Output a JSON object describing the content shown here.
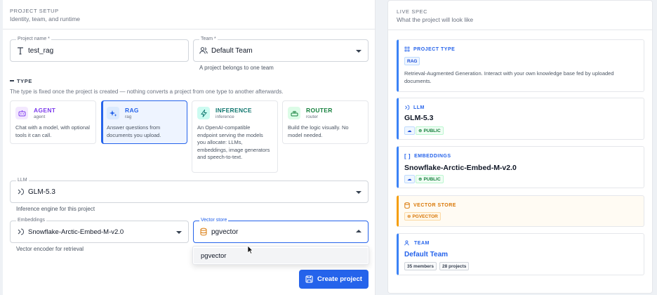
{
  "project_setup": {
    "title": "PROJECT SETUP",
    "subtitle": "Identity, team, and runtime",
    "project_name": {
      "label": "Project name *",
      "value": "test_rag"
    },
    "team": {
      "label": "Team *",
      "value": "Default Team",
      "helper": "A project belongs to one team"
    }
  },
  "type_section": {
    "title": "TYPE",
    "note": "The type is fixed once the project is created — nothing converts a project from one type to another afterwards.",
    "cards": [
      {
        "title": "AGENT",
        "sub": "agent",
        "desc": "Chat with a model, with optional tools it can call.",
        "icon": "robot-icon"
      },
      {
        "title": "RAG",
        "sub": "rag",
        "desc": "Answer questions from documents you upload.",
        "icon": "sparkles-icon"
      },
      {
        "title": "INFERENCE",
        "sub": "inference",
        "desc": "An OpenAI-compatible endpoint serving the models you allocate: LLMs, embeddings, image generators and speech-to-text.",
        "icon": "bolt-icon"
      },
      {
        "title": "ROUTER",
        "sub": "router",
        "desc": "Build the logic visually. No model needed.",
        "icon": "router-icon"
      }
    ],
    "selected": "RAG"
  },
  "llm": {
    "label": "LLM",
    "value": "GLM-5.3",
    "helper": "Inference engine for this project"
  },
  "embeddings": {
    "label": "Embeddings",
    "value": "Snowflake-Arctic-Embed-M-v2.0",
    "helper": "Vector encoder for retrieval"
  },
  "vector_store": {
    "label": "Vector store",
    "value": "pgvector",
    "options": [
      "pgvector"
    ]
  },
  "create_button": "Create project",
  "live_spec": {
    "title": "LIVE SPEC",
    "subtitle": "What the project will look like",
    "project_type": {
      "heading": "PROJECT TYPE",
      "chip": "RAG",
      "desc": "Retrieval-Augmented Generation. Interact with your own knowledge base fed by uploaded documents."
    },
    "llm": {
      "heading": "LLM",
      "name": "GLM-5.3",
      "chip": "PUBLIC"
    },
    "embeddings": {
      "heading": "EMBEDDINGS",
      "name": "Snowflake-Arctic-Embed-M-v2.0",
      "chip": "PUBLIC"
    },
    "vector_store": {
      "heading": "VECTOR STORE",
      "chip": "PGVECTOR"
    },
    "team": {
      "heading": "TEAM",
      "name": "Default Team",
      "members": "35 members",
      "projects": "28 projects"
    }
  },
  "colors": {
    "accent": "#2563eb",
    "agent": "#7c3aed",
    "rag": "#2563eb",
    "inference": "#0f766e",
    "router": "#15803d",
    "vector_store": "#f59e0b",
    "public": "#15803d"
  }
}
